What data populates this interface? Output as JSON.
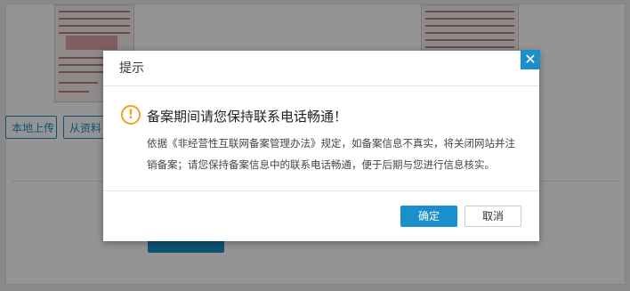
{
  "background": {
    "local_upload_label": "本地上传",
    "from_library_label": "从资料"
  },
  "modal": {
    "title": "提示",
    "close_glyph": "✕",
    "alert_icon": "warning-icon",
    "alert_glyph": "!",
    "alert_title": "备案期间请您保持联系电话畅通！",
    "alert_body": "依据《非经营性互联网备案管理办法》规定，如备案信息不真实，将关闭网站并注销备案；请您保持备案信息中的联系电话畅通，便于后期与您进行信息核实。",
    "confirm_label": "确定",
    "cancel_label": "取消"
  },
  "colors": {
    "accent": "#1b8fc9",
    "warning": "#f0a11f"
  }
}
